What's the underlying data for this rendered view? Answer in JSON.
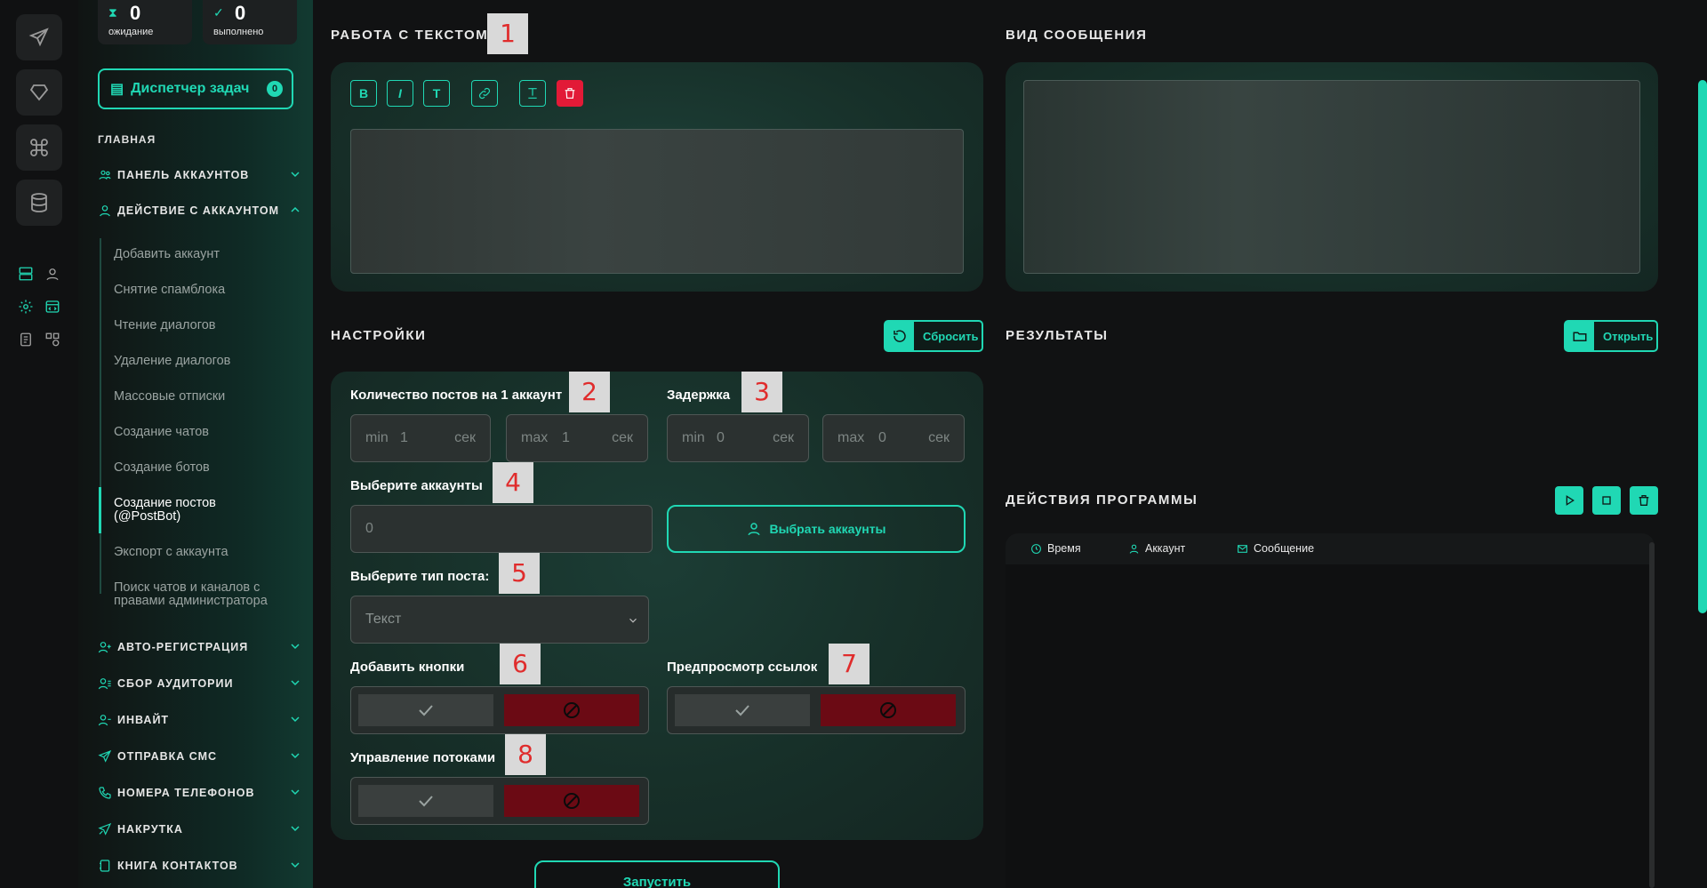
{
  "stats": {
    "waiting": {
      "count": "0",
      "label": "ожидание"
    },
    "done": {
      "count": "0",
      "label": "выполнено"
    }
  },
  "dispatcher": {
    "label": "Диспетчер задач",
    "badge": "0"
  },
  "sidebar": {
    "section": "ГЛАВНАЯ",
    "groups_top": [
      {
        "label": "ПАНЕЛЬ АККАУНТОВ"
      },
      {
        "label": "ДЕЙСТВИЕ С АККАУНТОМ"
      }
    ],
    "sub_items": [
      "Добавить аккаунт",
      "Снятие спамблока",
      "Чтение диалогов",
      "Удаление диалогов",
      "Массовые отписки",
      "Создание чатов",
      "Создание ботов",
      "Создание постов (@PostBot)",
      "Экспорт с аккаунта",
      "Поиск чатов и каналов с правами администратора"
    ],
    "groups_bottom": [
      "АВТО-РЕГИСТРАЦИЯ",
      "СБОР АУДИТОРИИ",
      "ИНВАЙТ",
      "ОТПРАВКА СМС",
      "НОМЕРА ТЕЛЕФОНОВ",
      "НАКРУТКА",
      "КНИГА КОНТАКТОВ"
    ]
  },
  "text_section": {
    "title": "РАБОТА С ТЕКСТОМ",
    "toolbar": {
      "bold": "B",
      "italic": "I",
      "text": "T"
    }
  },
  "preview_section": {
    "title": "ВИД СООБЩЕНИЯ"
  },
  "settings": {
    "title": "НАСТРОЙКИ",
    "reset_label": "Сбросить",
    "posts_label": "Количество постов на 1 аккаунт",
    "delay_label": "Задержка",
    "posts_min": {
      "prefix": "min",
      "value": "1",
      "suffix": "сек"
    },
    "posts_max": {
      "prefix": "max",
      "value": "1",
      "suffix": "сек"
    },
    "delay_min": {
      "prefix": "min",
      "value": "0",
      "suffix": "сек"
    },
    "delay_max": {
      "prefix": "max",
      "value": "0",
      "suffix": "сек"
    },
    "accounts_label": "Выберите аккаунты",
    "accounts_value": "0",
    "choose_accounts": "Выбрать аккаунты",
    "post_type_label": "Выберите тип поста:",
    "post_type_value": "Текст",
    "buttons_label": "Добавить кнопки",
    "link_preview_label": "Предпросмотр ссылок",
    "threads_label": "Управление потоками",
    "run_label": "Запустить"
  },
  "results": {
    "title": "РЕЗУЛЬТАТЫ",
    "open_label": "Открыть"
  },
  "actions": {
    "title": "ДЕЙСТВИЯ ПРОГРАММЫ",
    "columns": [
      "Время",
      "Аккаунт",
      "Сообщение"
    ]
  },
  "markers": [
    "1",
    "2",
    "3",
    "4",
    "5",
    "6",
    "7",
    "8"
  ],
  "colors": {
    "accent": "#20d8b4",
    "danger": "#e21a37",
    "danger_dark": "#6b0a14"
  }
}
